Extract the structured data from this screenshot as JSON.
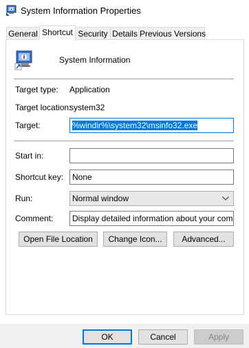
{
  "window": {
    "title": "System Information Properties",
    "icon": "system-information-icon"
  },
  "tabs": [
    {
      "label": "General",
      "active": false
    },
    {
      "label": "Shortcut",
      "active": true
    },
    {
      "label": "Security",
      "active": false
    },
    {
      "label": "Details",
      "active": false
    },
    {
      "label": "Previous Versions",
      "active": false
    }
  ],
  "shortcut": {
    "app_icon": "system-information-icon",
    "app_name": "System Information",
    "target_type": {
      "label": "Target type:",
      "value": "Application"
    },
    "target_location": {
      "label": "Target location:",
      "value": "system32"
    },
    "target": {
      "label": "Target:",
      "value": "%windir%\\system32\\msinfo32.exe",
      "selected": true
    },
    "start_in": {
      "label": "Start in:",
      "value": ""
    },
    "shortcut_key": {
      "label": "Shortcut key:",
      "value": "None"
    },
    "run": {
      "label": "Run:",
      "value": "Normal window",
      "icon": "chevron-down-icon"
    },
    "comment": {
      "label": "Comment:",
      "value": "Display detailed information about your computer."
    },
    "buttons": {
      "open_file_location": "Open File Location",
      "change_icon": "Change Icon...",
      "advanced": "Advanced..."
    }
  },
  "footer": {
    "ok": "OK",
    "cancel": "Cancel",
    "apply": "Apply",
    "apply_enabled": false
  },
  "colors": {
    "accent": "#0078d7",
    "selection_bg": "#0078d7",
    "button_bg": "#e1e1e1",
    "disabled_text": "#838383"
  }
}
